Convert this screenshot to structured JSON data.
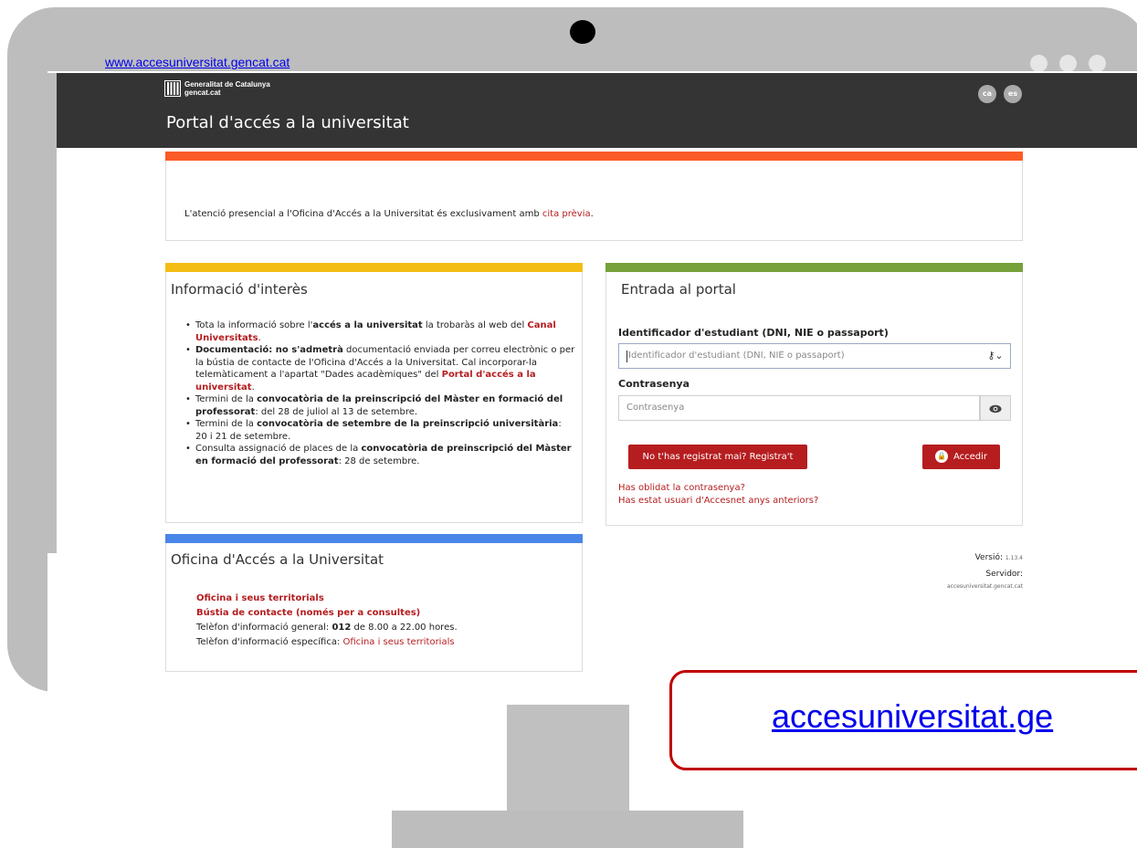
{
  "browser": {
    "url": "www.accesuniversitat.gencat.cat"
  },
  "header": {
    "gencat_line1": "Generalitat de Catalunya",
    "gencat_line2": "gencat.cat",
    "title": "Portal d'accés a la universitat",
    "languages": [
      "ca",
      "es"
    ]
  },
  "notice": {
    "text_before": "L'atenció presencial a l'Oficina d'Accés a la Universitat és exclusivament amb ",
    "link": "cita prèvia",
    "text_after": "."
  },
  "info": {
    "title": "Informació d'interès",
    "items": [
      {
        "p1": "Tota la informació sobre l'",
        "b1": "accés a la universitat",
        "p2": " la trobaràs al web del ",
        "link1": "Canal Universitats",
        "p3": "."
      },
      {
        "b1": "Documentació: no s'admetrà",
        "p1": " documentació enviada per correu electrònic o per la bústia de contacte de l'Oficina d'Accés a la Universitat. Cal incorporar-la telemàticament a l'apartat \"Dades acadèmiques\" del ",
        "link1": "Portal d'accés a la universitat",
        "p2": "."
      },
      {
        "p1": "Termini de la ",
        "b1": "convocatòria de la preinscripció del Màster en formació del professorat",
        "p2": ": del 28 de juliol al 13 de setembre."
      },
      {
        "p1": "Termini de la ",
        "b1": "convocatòria de setembre de la preinscripció universitària",
        "p2": ": 20 i 21 de setembre."
      },
      {
        "p1": "Consulta assignació de places de la ",
        "b1": "convocatòria de preinscripció del Màster en formació del professorat",
        "p2": ": 28 de setembre."
      }
    ]
  },
  "login": {
    "title": "Entrada al portal",
    "id_label": "Identificador d'estudiant (DNI, NIE o passaport)",
    "id_placeholder": "Identificador d'estudiant (DNI, NIE o passaport)",
    "password_label": "Contrasenya",
    "password_placeholder": "Contrasenya",
    "register_button": "No t'has registrat mai? Registra't",
    "login_button": "Accedir",
    "forgot_link": "Has oblidat la contrasenya?",
    "previous_user_link": "Has estat usuari d'Accesnet anys anteriors?"
  },
  "version": {
    "version_label": "Versió:",
    "version_value": "1.13.4",
    "server_label": "Servidor:",
    "server_value": "accesuniversitat.gencat.cat"
  },
  "office": {
    "title": "Oficina d'Accés a la Universitat",
    "link1": "Oficina i seus territorials",
    "link2": "Bústia de contacte (només per a consultes)",
    "phone_general_prefix": "Telèfon d'informació general: ",
    "phone_general_number": "012",
    "phone_general_suffix": " de 8.00 a 22.00 hores.",
    "phone_specific_prefix": "Telèfon d'informació específica: ",
    "phone_specific_link": "Oficina i seus territorials"
  },
  "callout": {
    "text": "accesuniversitat.ge"
  },
  "colors": {
    "notice_bar": "#fb5b26",
    "info_bar": "#f3bd16",
    "login_bar": "#77a13a",
    "office_bar": "#4a86e8",
    "brand_red": "#b61d1f",
    "header_bg": "#343434"
  },
  "icons": {
    "key": "key-icon",
    "eye": "eye-icon",
    "lock": "lock-icon"
  }
}
